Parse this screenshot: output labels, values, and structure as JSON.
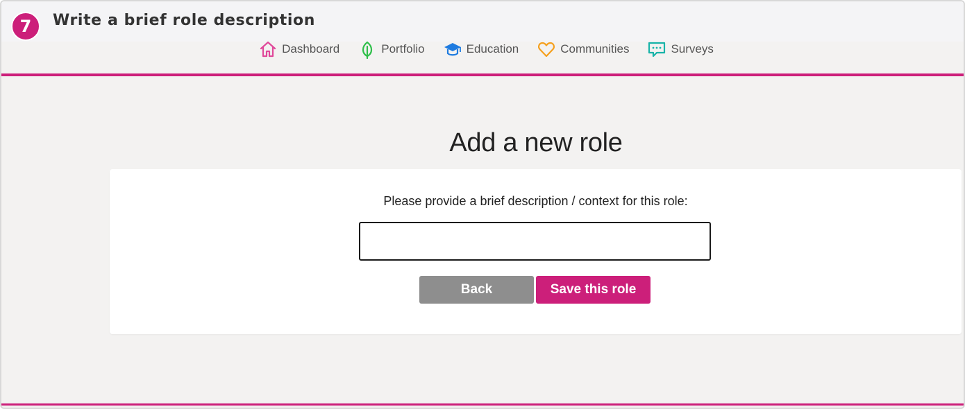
{
  "step": {
    "number": "7",
    "title": "Write a brief role description"
  },
  "nav": {
    "items": [
      {
        "label": "Dashboard",
        "icon": "home-icon",
        "color": "#e0489a"
      },
      {
        "label": "Portfolio",
        "icon": "leaf-icon",
        "color": "#2fbf4a"
      },
      {
        "label": "Education",
        "icon": "graduation-cap-icon",
        "color": "#1e7be0"
      },
      {
        "label": "Communities",
        "icon": "heart-icon",
        "color": "#f5a01e"
      },
      {
        "label": "Surveys",
        "icon": "chat-bubble-icon",
        "color": "#18b3a8"
      }
    ]
  },
  "main": {
    "title": "Add a new role",
    "prompt": "Please provide a brief description / context for this role:",
    "description_value": "",
    "back_label": "Back",
    "save_label": "Save this role"
  },
  "colors": {
    "accent": "#cc1f7a",
    "back_button": "#8e8e8e",
    "page_background": "#f3f2f1"
  }
}
